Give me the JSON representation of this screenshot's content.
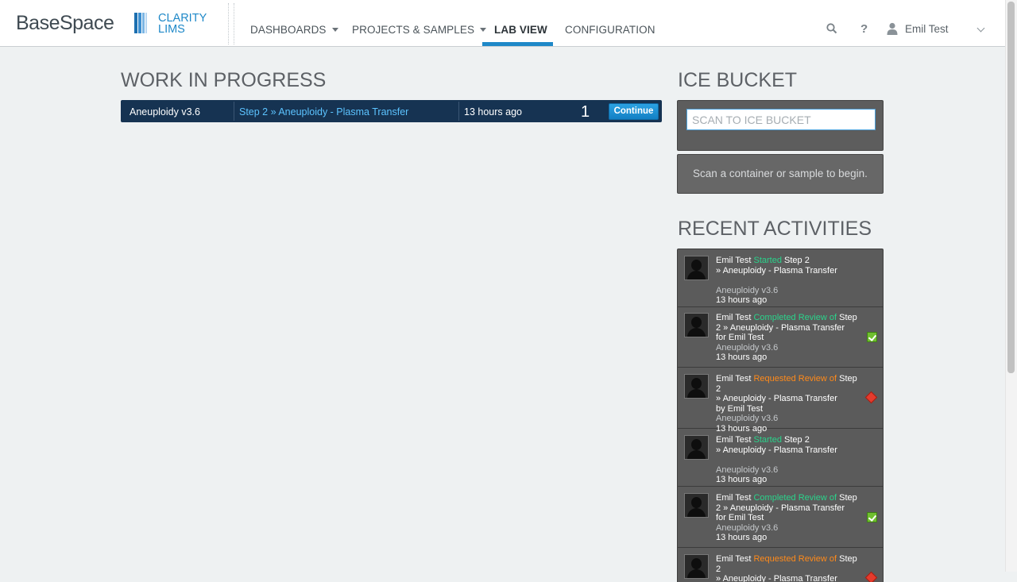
{
  "header": {
    "logo_main": "BaseSpace",
    "logo_line1": "CLARITY",
    "logo_line2": "LIMS",
    "nav": [
      {
        "label": "DASHBOARDS"
      },
      {
        "label": "PROJECTS & SAMPLES"
      },
      {
        "label": "LAB VIEW"
      },
      {
        "label": "CONFIGURATION"
      }
    ],
    "active_nav": "LAB VIEW",
    "user_name": "Emil Test",
    "icons": [
      "search-icon",
      "help-icon",
      "user-icon",
      "chevron-down-icon"
    ],
    "accent_color": "#1e88c8"
  },
  "wip": {
    "title": "WORK IN PROGRESS",
    "rows": [
      {
        "protocol": "Aneuploidy v3.6",
        "step": "Step 2 » Aneuploidy - Plasma Transfer",
        "time": "13 hours ago",
        "count": "1",
        "button": "Continue"
      }
    ]
  },
  "ice_bucket": {
    "title": "ICE BUCKET",
    "placeholder": "SCAN TO ICE BUCKET",
    "message": "Scan a container or sample to begin."
  },
  "activities": {
    "title": "RECENT ACTIVITIES",
    "items": [
      {
        "user": "Emil Test",
        "verb": "Started",
        "verb_color": "green",
        "line_a": "Step 2",
        "line_b": "» Aneuploidy - Plasma Transfer",
        "line_c": "",
        "project": "Aneuploidy v3.6",
        "time": "13 hours ago",
        "icon": ""
      },
      {
        "user": "Emil Test",
        "verb": "Completed Review of",
        "verb_color": "green",
        "line_a": "Step",
        "line_b": "2 » Aneuploidy - Plasma Transfer",
        "line_c": "for Emil Test",
        "project": "Aneuploidy v3.6",
        "time": "13 hours ago",
        "icon": "check-icon"
      },
      {
        "user": "Emil Test",
        "verb": "Requested Review of",
        "verb_color": "orange",
        "line_a": "Step 2",
        "line_b": "» Aneuploidy - Plasma Transfer",
        "line_c": "by Emil Test",
        "project": "Aneuploidy v3.6",
        "time": "13 hours ago",
        "icon": "flag-icon"
      },
      {
        "user": "Emil Test",
        "verb": "Started",
        "verb_color": "green",
        "line_a": "Step 2",
        "line_b": "» Aneuploidy - Plasma Transfer",
        "line_c": "",
        "project": "Aneuploidy v3.6",
        "time": "13 hours ago",
        "icon": ""
      },
      {
        "user": "Emil Test",
        "verb": "Completed Review of",
        "verb_color": "green",
        "line_a": "Step",
        "line_b": "2 » Aneuploidy - Plasma Transfer",
        "line_c": "for Emil Test",
        "project": "Aneuploidy v3.6",
        "time": "13 hours ago",
        "icon": "check-icon"
      },
      {
        "user": "Emil Test",
        "verb": "Requested Review of",
        "verb_color": "orange",
        "line_a": "Step 2",
        "line_b": "» Aneuploidy - Plasma Transfer",
        "line_c": "",
        "project": "",
        "time": "",
        "icon": "flag-icon"
      }
    ]
  }
}
